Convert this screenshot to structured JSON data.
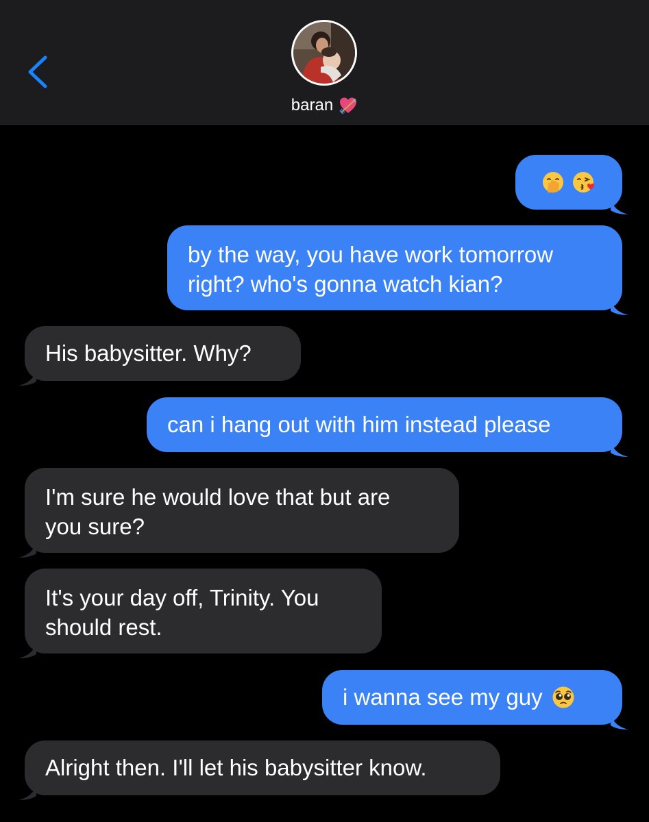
{
  "header": {
    "contact_name": "baran",
    "back_icon": "chevron-left-icon",
    "name_emoji": "heart-with-arrow-icon",
    "avatar": "contact-avatar-photo"
  },
  "colors": {
    "sent_bubble": "#3b82f6",
    "received_bubble": "#2c2c2e",
    "header_bg": "#1c1c1e",
    "background": "#000000",
    "accent": "#1a82fb"
  },
  "messages": [
    {
      "from": "me",
      "emojis": [
        "face-with-hand-over-mouth-icon",
        "face-blowing-kiss-icon"
      ]
    },
    {
      "from": "me",
      "lines": [
        "by the way, you have work tomorrow",
        "right? who's gonna watch kian?"
      ]
    },
    {
      "from": "them",
      "lines": [
        "His babysitter. Why?"
      ]
    },
    {
      "from": "me",
      "lines": [
        "can i hang out with him instead please"
      ]
    },
    {
      "from": "them",
      "lines": [
        "I'm sure he would love that but are",
        "you sure?"
      ]
    },
    {
      "from": "them",
      "lines": [
        "It's your day off, Trinity. You",
        "should rest."
      ]
    },
    {
      "from": "me",
      "lines": [
        "i wanna see my guy"
      ],
      "trailing_emoji": "pleading-face-icon"
    },
    {
      "from": "them",
      "lines": [
        "Alright then. I'll let his babysitter know."
      ]
    }
  ]
}
